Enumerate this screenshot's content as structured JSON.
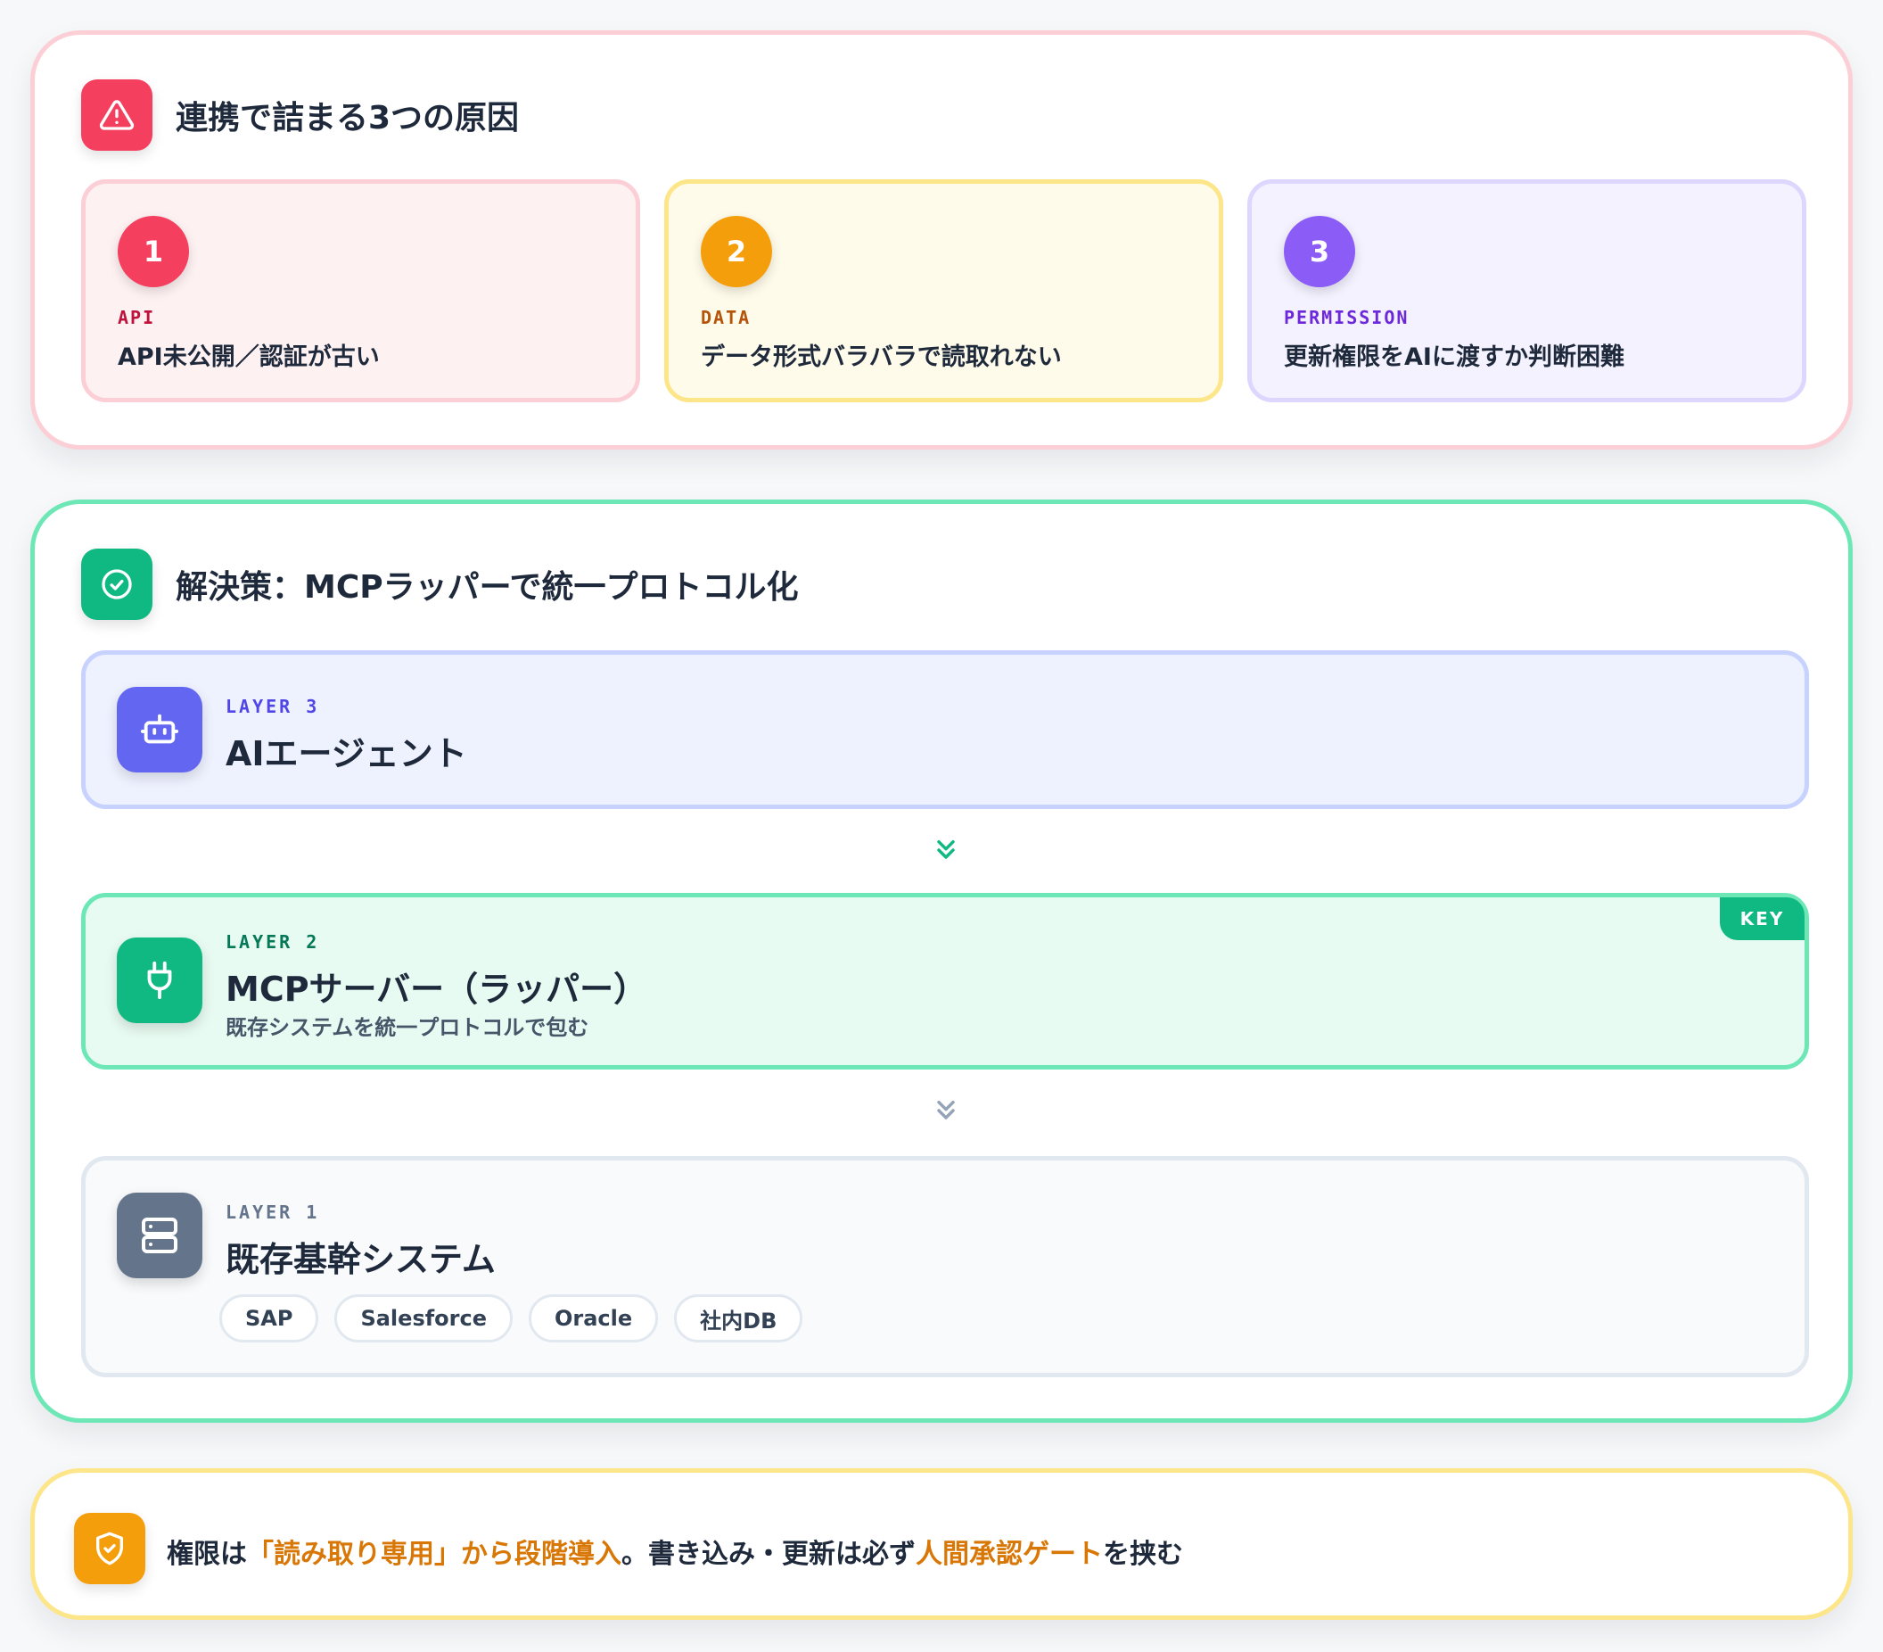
{
  "causes_section": {
    "title": "連携で詰まる3つの原因",
    "cards": [
      {
        "number": "1",
        "tag": "API",
        "text": "API未公開／認証が古い",
        "color": "#f43f5e"
      },
      {
        "number": "2",
        "tag": "DATA",
        "text": "データ形式バラバラで読取れない",
        "color": "#f59e0b"
      },
      {
        "number": "3",
        "tag": "PERMISSION",
        "text": "更新権限をAIに渡すか判断困難",
        "color": "#8b5cf6"
      }
    ]
  },
  "solution_section": {
    "title": "解決策：MCPラッパーで統一プロトコル化",
    "layers": {
      "layer3": {
        "tag": "LAYER 3",
        "title": "AIエージェント",
        "icon": "robot-icon",
        "color": "#6366f1"
      },
      "layer2": {
        "tag": "LAYER 2",
        "title": "MCPサーバー（ラッパー）",
        "subtitle": "既存システムを統一プロトコルで包む",
        "badge": "KEY",
        "icon": "plug-icon",
        "color": "#10b981"
      },
      "layer1": {
        "tag": "LAYER 1",
        "title": "既存基幹システム",
        "icon": "server-icon",
        "color": "#64748b",
        "systems": [
          "SAP",
          "Salesforce",
          "Oracle",
          "社内DB"
        ]
      }
    }
  },
  "note": {
    "part1": "権限は",
    "highlight1": "「読み取り専用」から段階導入",
    "part2": "。書き込み・更新は必ず",
    "highlight2": "人間承認ゲート",
    "part3": "を挟む",
    "icon": "shield-check-icon",
    "accent": "#d97706"
  }
}
